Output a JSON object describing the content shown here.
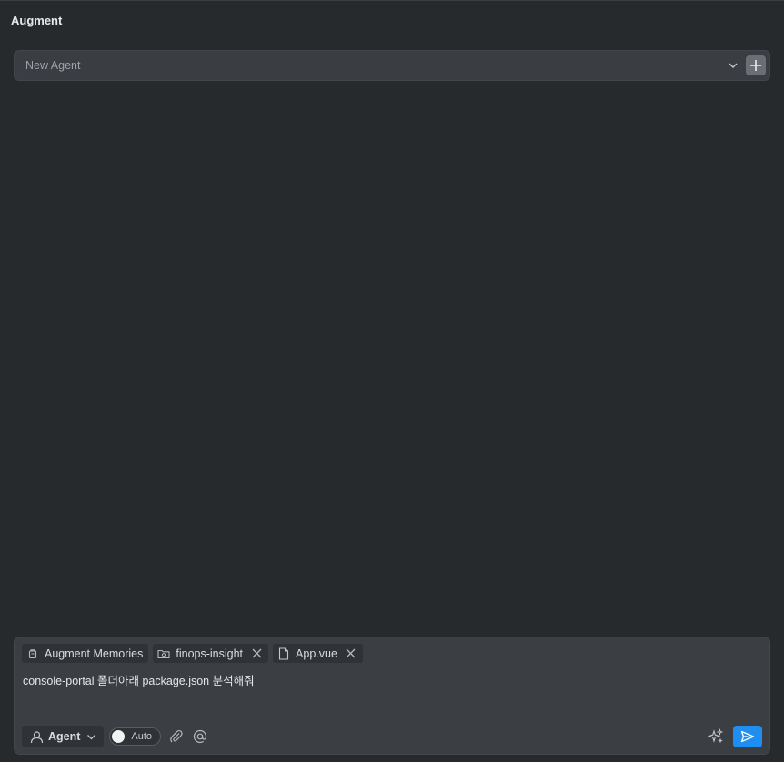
{
  "panel": {
    "title": "Augment"
  },
  "thread": {
    "label": "New Agent"
  },
  "composer": {
    "chips": [
      {
        "label": "Augment Memories",
        "icon": "memory-icon",
        "removable": false
      },
      {
        "label": "finops-insight",
        "icon": "folder-icon",
        "removable": true
      },
      {
        "label": "App.vue",
        "icon": "file-icon",
        "removable": true
      }
    ],
    "message": "console-portal 폴더아래 package.json 분석해줘",
    "mode_label": "Agent",
    "auto_label": "Auto"
  },
  "icons": {
    "chevron": "chevron-down-icon",
    "add": "plus-icon",
    "attach": "paperclip-icon",
    "mention": "at-icon",
    "enhance": "sparkle-icon",
    "send": "send-icon"
  },
  "colors": {
    "background": "#272a2d",
    "send_button": "#1e8ff0"
  }
}
